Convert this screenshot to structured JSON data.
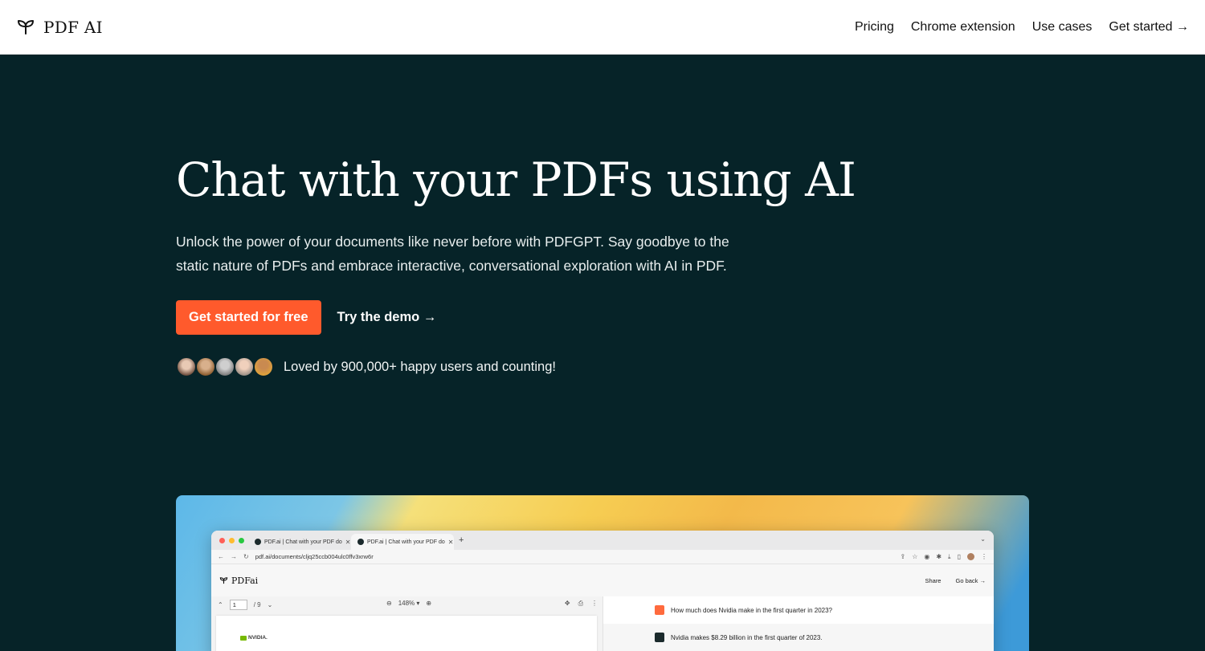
{
  "nav": {
    "brand": "PDF AI",
    "links": [
      "Pricing",
      "Chrome extension",
      "Use cases",
      "Get started →"
    ]
  },
  "hero": {
    "title": "Chat with your PDFs using AI",
    "subtitle": "Unlock the power of your documents like never before with PDFGPT. Say goodbye to the static nature of PDFs and embrace interactive, conversational exploration with AI in PDF.",
    "primary_cta": "Get started for free",
    "secondary_cta": "Try the demo →",
    "social_proof": "Loved by 900,000+ happy users and counting!"
  },
  "showcase": {
    "tabs": [
      "PDF.ai | Chat with your PDF do",
      "PDF.ai | Chat with your PDF do"
    ],
    "url": "pdf.ai/documents/cljq25ccb004ulc0ffv3xrw6r",
    "app_brand": "PDFai",
    "share": "Share",
    "go_back": "Go back →",
    "page_current": "1",
    "page_total": "/ 9",
    "zoom": "148% ▾",
    "doc_logo": "NVIDIA.",
    "question": "How much does Nvidia make in the first quarter in 2023?",
    "answer": "Nvidia makes $8.29 billion in the first quarter of 2023."
  },
  "colors": {
    "background": "#062328",
    "accent": "#ff5a2c",
    "nav_bg": "#ffffff"
  }
}
